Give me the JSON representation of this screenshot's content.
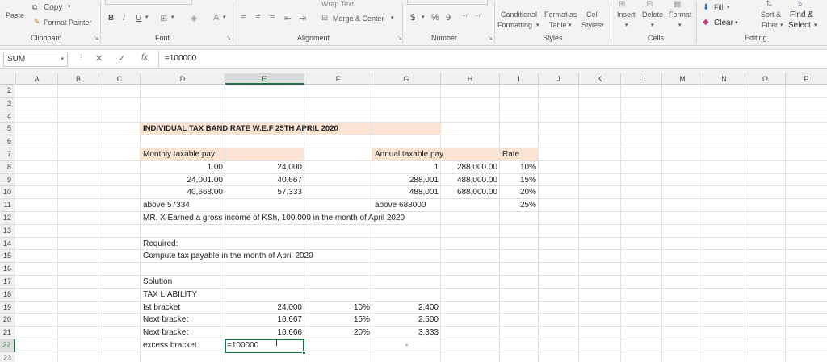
{
  "ribbon": {
    "clipboard": {
      "paste": "Paste",
      "copy": "Copy",
      "format_painter": "Format Painter",
      "group_label": "Clipboard"
    },
    "font": {
      "bold": "B",
      "italic": "I",
      "underline": "U",
      "font_color": "A",
      "group_label": "Font"
    },
    "alignment": {
      "wrap_text": "Wrap Text",
      "merge_center": "Merge & Center",
      "group_label": "Alignment"
    },
    "number": {
      "currency": "$",
      "percent": "%",
      "comma": "9",
      "group_label": "Number"
    },
    "styles": {
      "conditional": "Conditional",
      "formatting": "Formatting",
      "format_as": "Format as",
      "table": "Table",
      "cell": "Cell",
      "cell_styles": "Styles",
      "group_label": "Styles"
    },
    "cells": {
      "insert": "Insert",
      "delete": "Delete",
      "format": "Format",
      "group_label": "Cells"
    },
    "editing": {
      "fill": "Fill",
      "clear": "Clear",
      "sort_filter": "Sort &",
      "filter": "Filter",
      "find_select": "Find &",
      "select": "Select",
      "group_label": "Editing"
    }
  },
  "formula_bar": {
    "name_box": "SUM",
    "cancel": "✕",
    "enter": "✓",
    "fx": "fx",
    "content": "=100000"
  },
  "columns": [
    "A",
    "B",
    "C",
    "D",
    "E",
    "F",
    "G",
    "H",
    "I",
    "J",
    "K",
    "L",
    "M",
    "N",
    "O",
    "P"
  ],
  "rows": [
    "2",
    "3",
    "4",
    "5",
    "6",
    "7",
    "8",
    "9",
    "10",
    "11",
    "12",
    "13",
    "14",
    "15",
    "16",
    "17",
    "18",
    "19",
    "20",
    "21",
    "22",
    "23"
  ],
  "cells": {
    "D5": "INDIVIDUAL TAX BAND RATE W.E.F 25TH APRIL 2020",
    "D7": "Monthly taxable pay",
    "G7": "Annual taxable pay",
    "I7": "Rate",
    "D8": "1.00",
    "E8": "24,000",
    "G8": "1",
    "H8": "288,000.00",
    "I8": "10%",
    "D9": "24,001.00",
    "E9": "40,667",
    "G9": "288,001",
    "H9": "488,000.00",
    "I9": "15%",
    "D10": "40,668.00",
    "E10": "57,333",
    "G10": "488,001",
    "H10": "688,000.00",
    "I10": "20%",
    "D11": "above 57334",
    "G11": "above 688000",
    "I11": "25%",
    "D12": "MR. X Earned a gross income of KSh, 100,000 in the month of April 2020",
    "D14": "Required:",
    "D15": "Compute tax payable in the month of April 2020",
    "D17": "Solution",
    "D18": "TAX LIABILITY",
    "D19": "Ist bracket",
    "E19": "24,000",
    "F19": "10%",
    "G19": "2,400",
    "D20": "Next bracket",
    "E20": "16,667",
    "F20": "15%",
    "G20": "2,500",
    "D21": "Next bracket",
    "E21": "16,666",
    "F21": "20%",
    "G21": "3,333",
    "D22": "excess bracket",
    "E22": "=100000",
    "G22": "-"
  },
  "colors": {
    "accent": "#217346",
    "highlight": "#fbe3d4"
  }
}
